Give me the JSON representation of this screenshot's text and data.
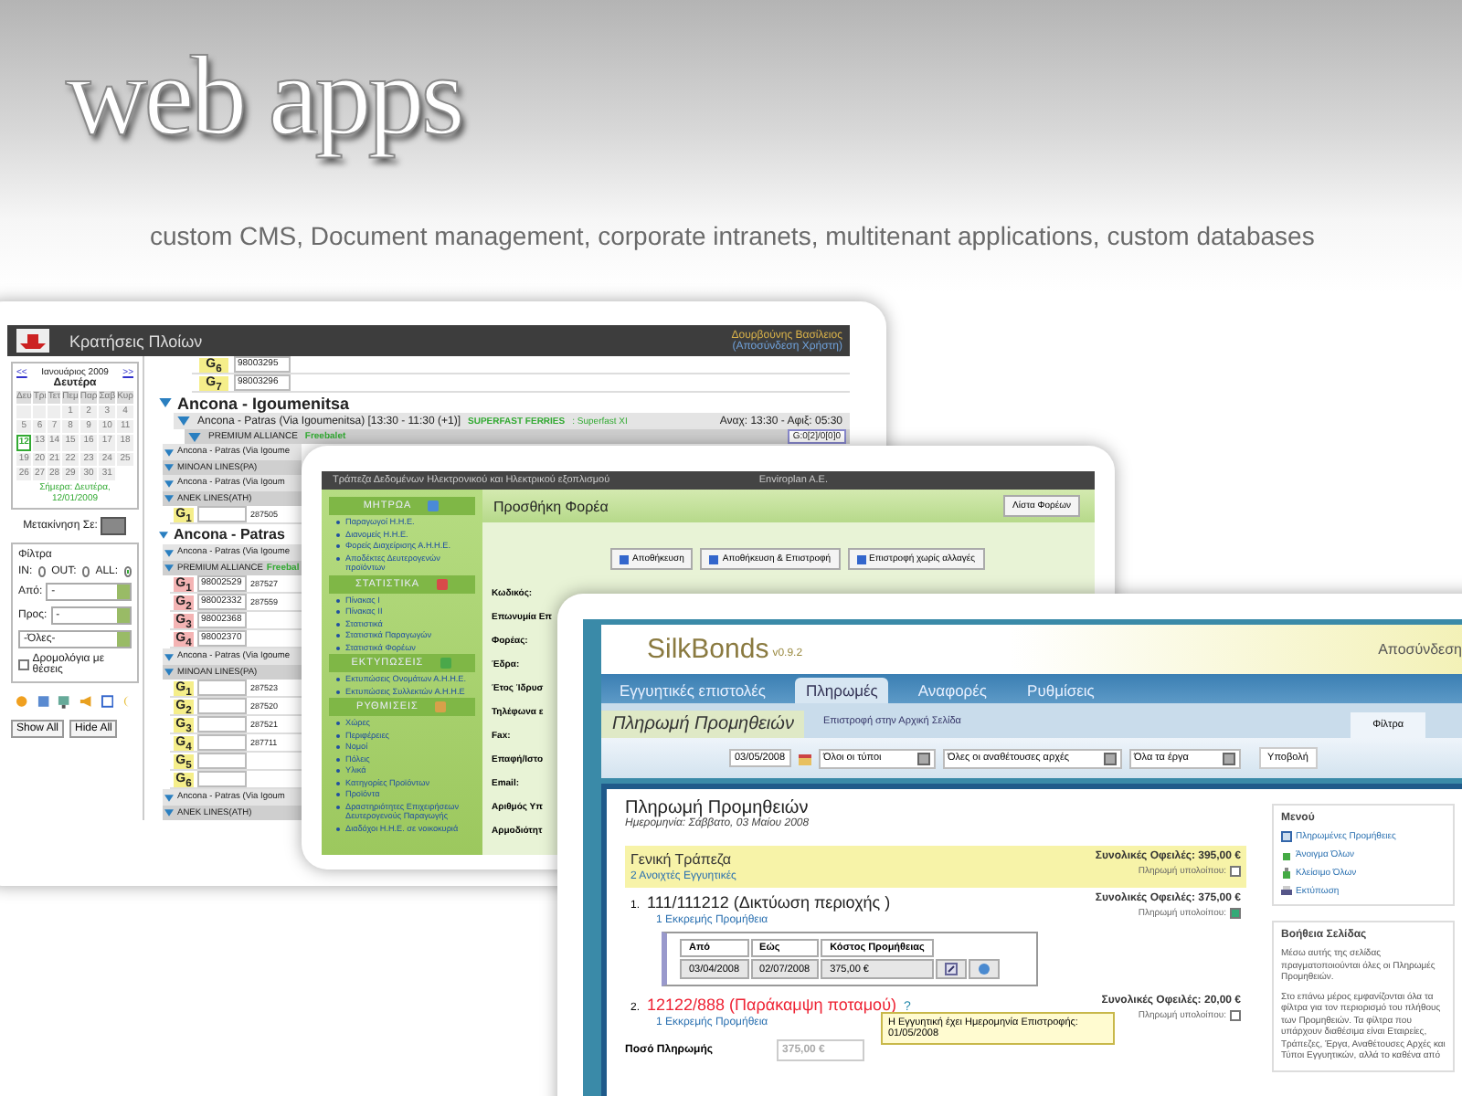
{
  "header": {
    "title": "web apps",
    "subtitle": "custom CMS, Document management, corporate intranets, multitenant applications, custom databases"
  },
  "ship_app": {
    "title": "Κρατήσεις Πλοίων",
    "user": "Δουρβούνης Βασίλειος",
    "logout": "(Αποσύνδεση Χρήστη)",
    "calendar": {
      "prev": "<<",
      "month": "Ιανουάριος 2009",
      "next": ">>",
      "day_name": "Δευτέρα",
      "weekdays": [
        "Δευ",
        "Τρι",
        "Τετ",
        "Πεμ",
        "Παρ",
        "Σαβ",
        "Κυρ"
      ],
      "days": [
        {
          "kind": "blank"
        },
        {
          "kind": "blank"
        },
        {
          "kind": "blank"
        },
        {
          "kind": "day",
          "label": "1",
          "selected": false
        },
        {
          "kind": "day",
          "label": "2",
          "selected": false
        },
        {
          "kind": "day",
          "label": "3",
          "selected": false
        },
        {
          "kind": "day",
          "label": "4",
          "selected": false
        },
        {
          "kind": "day",
          "label": "5",
          "selected": false
        },
        {
          "kind": "day",
          "label": "6",
          "selected": false
        },
        {
          "kind": "day",
          "label": "7",
          "selected": false
        },
        {
          "kind": "day",
          "label": "8",
          "selected": false
        },
        {
          "kind": "day",
          "label": "9",
          "selected": false
        },
        {
          "kind": "day",
          "label": "10",
          "selected": false
        },
        {
          "kind": "day",
          "label": "11",
          "selected": false
        },
        {
          "kind": "day",
          "label": "12",
          "selected": true
        },
        {
          "kind": "day",
          "label": "13",
          "selected": false
        },
        {
          "kind": "day",
          "label": "14",
          "selected": false
        },
        {
          "kind": "day",
          "label": "15",
          "selected": false
        },
        {
          "kind": "day",
          "label": "16",
          "selected": false
        },
        {
          "kind": "day",
          "label": "17",
          "selected": false
        },
        {
          "kind": "day",
          "label": "18",
          "selected": false
        },
        {
          "kind": "day",
          "label": "19",
          "selected": false
        },
        {
          "kind": "day",
          "label": "20",
          "selected": false
        },
        {
          "kind": "day",
          "label": "21",
          "selected": false
        },
        {
          "kind": "day",
          "label": "22",
          "selected": false
        },
        {
          "kind": "day",
          "label": "23",
          "selected": false
        },
        {
          "kind": "day",
          "label": "24",
          "selected": false
        },
        {
          "kind": "day",
          "label": "25",
          "selected": false
        },
        {
          "kind": "day",
          "label": "26",
          "selected": false
        },
        {
          "kind": "day",
          "label": "27",
          "selected": false
        },
        {
          "kind": "day",
          "label": "28",
          "selected": false
        },
        {
          "kind": "day",
          "label": "29",
          "selected": false
        },
        {
          "kind": "day",
          "label": "30",
          "selected": false
        },
        {
          "kind": "day",
          "label": "31",
          "selected": false
        }
      ],
      "today": "Σήμερα: Δευτέρα, 12/01/2009"
    },
    "move_to": "Μετακίνηση Σε:",
    "filters": {
      "legend": "Φίλτρα",
      "direction": [
        {
          "label": "IN:",
          "selected": false
        },
        {
          "label": "OUT:",
          "selected": false
        },
        {
          "label": "ALL:",
          "selected": true
        }
      ],
      "from_label": "Από:",
      "from_value": "-",
      "to_label": "Προς:",
      "to_value": "-",
      "company_value": "-Όλες-",
      "seats_label": "Δρομολόγια με θέσεις",
      "seats_checked": false
    },
    "buttons": [
      "Show All",
      "Hide All"
    ],
    "rows": [
      {
        "kind": "cabin",
        "label": "G$_{6}$",
        "code": "98003295",
        "color": "#f5ee8a"
      },
      {
        "kind": "cabin",
        "label": "G$_{7}$",
        "code": "98003296",
        "color": "#f5ee8a"
      },
      {
        "kind": "route",
        "text": "Ancona - Igoumenitsa"
      },
      {
        "kind": "trip",
        "text": "Ancona - Patras (Via Igoumenitsa) [13:30 - 11:30 (+1)]",
        "operator": "SUPERFAST FERRIES",
        "vessel": ": Superfast XI",
        "times": "Αναχ: 13:30 - Αφιξ: 05:30"
      },
      {
        "kind": "line",
        "text": "PREMIUM ALLIANCE",
        "vessel": "Freebalet",
        "counter": "G:0[2]/0[0]0"
      },
      {
        "kind": "trip",
        "text": "Ancona - Patras (Via Igoume"
      },
      {
        "kind": "line",
        "text": "MINOAN LINES(PA)"
      },
      {
        "kind": "trip",
        "text": "Ancona - Patras (Via Igoum"
      },
      {
        "kind": "line",
        "text": "ANEK LINES(ATH)"
      },
      {
        "kind": "cabin",
        "label": "G$_{1}$",
        "ticket": "287505",
        "color": "#f5ee8a"
      },
      {
        "kind": "route",
        "text": "Ancona - Patras"
      },
      {
        "kind": "trip",
        "text": "Ancona - Patras (Via Igoume"
      },
      {
        "kind": "line",
        "text": "PREMIUM ALLIANCE",
        "vessel": "Freebal"
      },
      {
        "kind": "cabin",
        "label": "G$_{1}$",
        "code": "98002529",
        "ticket": "287527",
        "color": "#f4b4b4"
      },
      {
        "kind": "cabin",
        "label": "G$_{2}$",
        "code": "98002332",
        "ticket": "287559",
        "color": "#f4b4b4"
      },
      {
        "kind": "cabin",
        "label": "G$_{3}$",
        "code": "98002368",
        "color": "#f4b4b4"
      },
      {
        "kind": "cabin",
        "label": "G$_{4}$",
        "code": "98002370",
        "color": "#f4b4b4"
      },
      {
        "kind": "trip",
        "text": "Ancona - Patras (Via Igoume"
      },
      {
        "kind": "line",
        "text": "MINOAN LINES(PA)"
      },
      {
        "kind": "cabin",
        "label": "G$_{1}$",
        "ticket": "287523",
        "color": "#f5ee8a"
      },
      {
        "kind": "cabin",
        "label": "G$_{2}$",
        "ticket": "287520",
        "color": "#f5ee8a"
      },
      {
        "kind": "cabin",
        "label": "G$_{3}$",
        "ticket": "287521",
        "color": "#f5ee8a"
      },
      {
        "kind": "cabin",
        "label": "G$_{4}$",
        "ticket": "287711",
        "color": "#f5ee8a"
      },
      {
        "kind": "cabin",
        "label": "G$_{5}$",
        "color": "#f5ee8a"
      },
      {
        "kind": "cabin",
        "label": "G$_{6}$",
        "color": "#f5ee8a"
      },
      {
        "kind": "trip",
        "text": "Ancona - Patras (Via Igoum"
      },
      {
        "kind": "line",
        "text": "ANEK LINES(ATH)"
      }
    ]
  },
  "registry_app": {
    "title": "Τράπεζα Δεδομένων Ηλεκτρονικού και Ηλεκτρικού εξοπλισμού",
    "company": "Enviroplan A.E.",
    "sections": [
      {
        "title": "ΜΗΤΡΩΑ",
        "items": [
          "Παραγωγοί Η.Η.Ε.",
          "Διανομείς Η.Η.Ε.",
          "Φορείς Διαχείρισης Α.Η.Η.Ε.",
          "Αποδέκτες Δευτερογενών προϊόντων"
        ]
      },
      {
        "title": "ΣΤΑΤΙΣΤΙΚΑ",
        "items": [
          "Πίνακας Ι",
          "Πίνακας ΙΙ",
          "Στατιστικά",
          "Στατιστικά Παραγωγών",
          "Στατιστικά Φορέων"
        ]
      },
      {
        "title": "ΕΚΤΥΠΩΣΕΙΣ",
        "items": [
          "Εκτυπώσεις Ονομάτων Α.Η.Η.Ε.",
          "Εκτυπώσεις Συλλεκτών Α.Η.Η.Ε"
        ]
      },
      {
        "title": "ΡΥΘΜΙΣΕΙΣ",
        "items": [
          "Χώρες",
          "Περιφέρειες",
          "Νομοί",
          "Πόλεις",
          "Υλικά",
          "Κατηγορίες Προϊόντων",
          "Προϊόντα",
          "Δραστηριότητες Επιχειρήσεων Δευτερογενούς Παραγωγής",
          "Διαδόχοι Η.Η.Ε. σε νοικοκυριά"
        ]
      }
    ],
    "page_title": "Προσθήκη Φορέα",
    "list_button": "Λίστα Φορέων",
    "actions": [
      "Αποθήκευση",
      "Αποθήκευση & Επιστροφή",
      "Επιστροφή χωρίς αλλαγές"
    ],
    "fields": [
      "Κωδικός:",
      "Επωνυμία Επ",
      "Φορέας:",
      "Έδρα:",
      "Έτος Ίδρυσ",
      "Τηλέφωνα ε",
      "Fax:",
      "Επαφή/Ιστο",
      "Email:",
      "Αριθμός Υπ",
      "Αρμοδιότητ"
    ]
  },
  "bonds_app": {
    "logo": "SilkBonds",
    "version": "v0.9.2",
    "logout": "Αποσύνδεση",
    "tabs": [
      {
        "label": "Εγγυητικές επιστολές",
        "selected": false
      },
      {
        "label": "Πληρωμές",
        "selected": true
      },
      {
        "label": "Αναφορές",
        "selected": false
      },
      {
        "label": "Ρυθμίσεις",
        "selected": false
      }
    ],
    "page_tab": "Πληρωμή Προμηθειών",
    "back_link": "Επιστροφή στην Αρχική Σελίδα",
    "filter_tab": "Φίλτρα",
    "filter": {
      "date": "03/05/2008",
      "selects": [
        "Όλοι οι τύποι",
        "Όλες οι αναθέτουσες αρχές",
        "Όλα τα έργα"
      ],
      "submit": "Υποβολή"
    },
    "heading": "Πληρωμή Προμηθειών",
    "date_line": "Ημερομηνία: Σάββατο, 03 Μαίου 2008",
    "bank": {
      "name": "Γενική Τράπεζα",
      "open": "2 Ανοιχτές Εγγυητικές",
      "total": "Συνολικές Οφειλές: 395,00 €",
      "pay_label": "Πληρωμή υπολοίπου:",
      "pay_checked": false
    },
    "bonds": [
      {
        "number": "1.",
        "title": "111/111212 (Δικτύωση περιοχής )",
        "overdue": false,
        "pending": "1 Εκκρεμής Προμήθεια",
        "total": "Συνολικές Οφειλές: 375,00 €",
        "pay_label": "Πληρωμή υπολοίπου:",
        "pay_checked": true,
        "table": {
          "columns": [
            "Από",
            "Εώς",
            "Κόστος Προμήθειας"
          ],
          "rows": [
            [
              "03/04/2008",
              "02/07/2008",
              "375,00 €"
            ]
          ]
        }
      },
      {
        "number": "2.",
        "title": "12122/888 (Παράκαμψη ποταμού)",
        "overdue": true,
        "help": "?",
        "pending": "1 Εκκρεμής Προμήθεια",
        "total": "Συνολικές Οφειλές: 20,00 €",
        "pay_label": "Πληρωμή υπολοίπου:",
        "pay_checked": false,
        "tooltip": "Η Εγγυητική έχει Ημερομηνία Επιστροφής: 01/05/2008"
      }
    ],
    "amount_label": "Ποσό Πληρωμής",
    "amount_value": "375,00 €",
    "menu": {
      "title": "Μενού",
      "items": [
        {
          "kind": "list",
          "label": "Πληρωμένες Προμήθειες"
        },
        {
          "kind": "open",
          "label": "Άνοιγμα Όλων"
        },
        {
          "kind": "close",
          "label": "Κλείσιμο Όλων"
        },
        {
          "kind": "print",
          "label": "Εκτύπωση"
        }
      ]
    },
    "help": {
      "title": "Βοήθεια Σελίδας",
      "paragraphs": [
        "Μέσω αυτής της σελίδας πραγματοποιούνται όλες οι Πληρωμές Προμηθειών.",
        "Στο επάνω μέρος εμφανίζονται όλα τα φίλτρα για τον περιορισμό του πλήθους των Προμηθειών. Τα φίλτρα που υπάρχουν διαθέσιμα είναι Εταιρείες, Τράπεζες, Έργα, Αναθέτουσες Αρχές και Τύποι Εγγυητικών, αλλά το καθένα από"
      ]
    }
  }
}
